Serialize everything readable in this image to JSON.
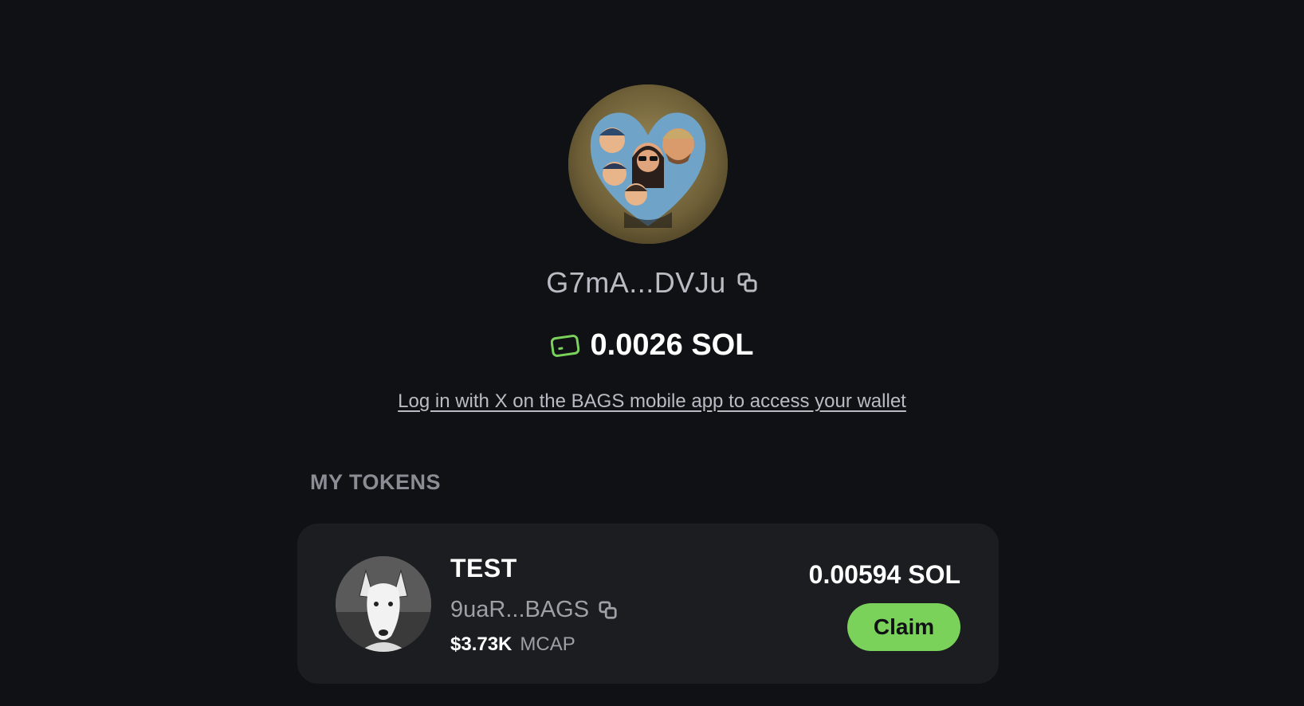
{
  "profile": {
    "address_short": "G7mA...DVJu",
    "avatar_icon": "family-heart-avatar",
    "copy_icon": "copy-icon"
  },
  "wallet": {
    "balance": "0.0026 SOL",
    "wallet_icon": "wallet-icon",
    "accent_color": "#7bd25b"
  },
  "login_link": "Log in with X on the BAGS mobile app to access your wallet",
  "tokens_section": {
    "title": "MY TOKENS",
    "tokens": [
      {
        "name": "TEST",
        "address_short": "9uaR...BAGS",
        "mcap_value": "$3.73K",
        "mcap_label": "MCAP",
        "sol_amount": "0.00594 SOL",
        "claim_label": "Claim",
        "avatar_icon": "dog-avatar"
      }
    ]
  },
  "colors": {
    "background": "#0f1115",
    "card": "#1c1d21",
    "claim_button": "#7bd25b",
    "muted_text": "#9da0a7"
  }
}
